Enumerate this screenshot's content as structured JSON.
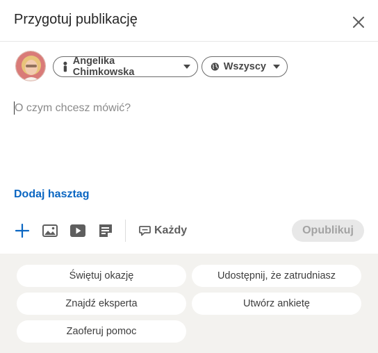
{
  "header": {
    "title": "Przygotuj publikację"
  },
  "author": {
    "name": "Angelika Chimkowska"
  },
  "visibility": {
    "label": "Wszyscy"
  },
  "composer": {
    "placeholder": "O czym chcesz mówić?"
  },
  "hashtag": {
    "label": "Dodaj hasztag"
  },
  "toolbar": {
    "comments_label": "Każdy",
    "publish_label": "Opublikuj"
  },
  "suggestions": [
    {
      "label": "Świętuj okazję"
    },
    {
      "label": "Udostępnij, że zatrudniasz"
    },
    {
      "label": "Znajdź eksperta"
    },
    {
      "label": "Utwórz ankietę"
    },
    {
      "label": "Zaoferuj pomoc"
    }
  ],
  "colors": {
    "accent": "#0a66c2",
    "panel_background": "#f3f2ef",
    "publish_disabled_bg": "#e8e8e8"
  },
  "icons": {
    "close": "close-icon",
    "add": "plus-icon",
    "photo": "image-icon",
    "video": "video-icon",
    "document": "document-icon",
    "comment": "comment-icon",
    "person": "person-icon",
    "globe": "globe-icon"
  }
}
